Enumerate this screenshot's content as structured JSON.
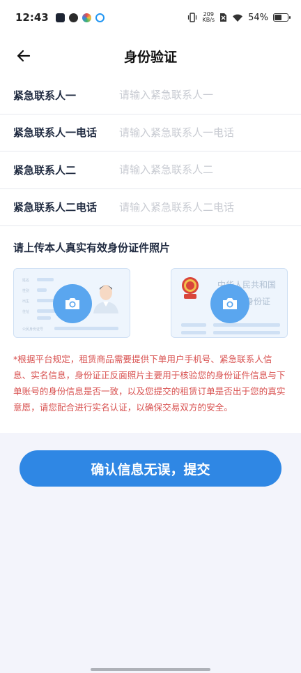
{
  "status_bar": {
    "time": "12:43",
    "net_speed_value": "209",
    "net_speed_unit": "KB/s",
    "battery_percent": "54%",
    "battery_level": 0.54,
    "app_icons": [
      "play-icon",
      "leaf-icon",
      "flower-icon",
      "browser-icon"
    ]
  },
  "header": {
    "title": "身份验证",
    "back_icon": "back-arrow-icon"
  },
  "form": {
    "fields": [
      {
        "label": "紧急联系人一",
        "placeholder": "请输入紧急联系人一",
        "value": ""
      },
      {
        "label": "紧急联系人一电话",
        "placeholder": "请输入紧急联系人一电话",
        "value": ""
      },
      {
        "label": "紧急联系人二",
        "placeholder": "请输入紧急联系人二",
        "value": ""
      },
      {
        "label": "紧急联系人二电话",
        "placeholder": "请输入紧急联系人二电话",
        "value": ""
      }
    ]
  },
  "upload": {
    "title": "请上传本人真实有效身份证件照片",
    "back_card_text_1": "中华人民共和国",
    "back_card_text_2": "身份证",
    "front_card_fields": [
      "姓名",
      "性别",
      "出生",
      "住址",
      "公民身份证号"
    ]
  },
  "notice": "*根据平台规定，租赁商品需要提供下单用户手机号、紧急联系人信息、实名信息，身份证正反面照片主要用于核验您的身份证件信息与下单账号的身份信息是否一致，以及您提交的租赁订单是否出于您的真实意愿，请您配合进行实名认证，以确保交易双方的安全。",
  "submit_label": "确认信息无误，提交",
  "colors": {
    "primary": "#2f87e4",
    "camera": "#5aa6ef",
    "notice": "#d8504f",
    "background": "#f3f4fb"
  }
}
